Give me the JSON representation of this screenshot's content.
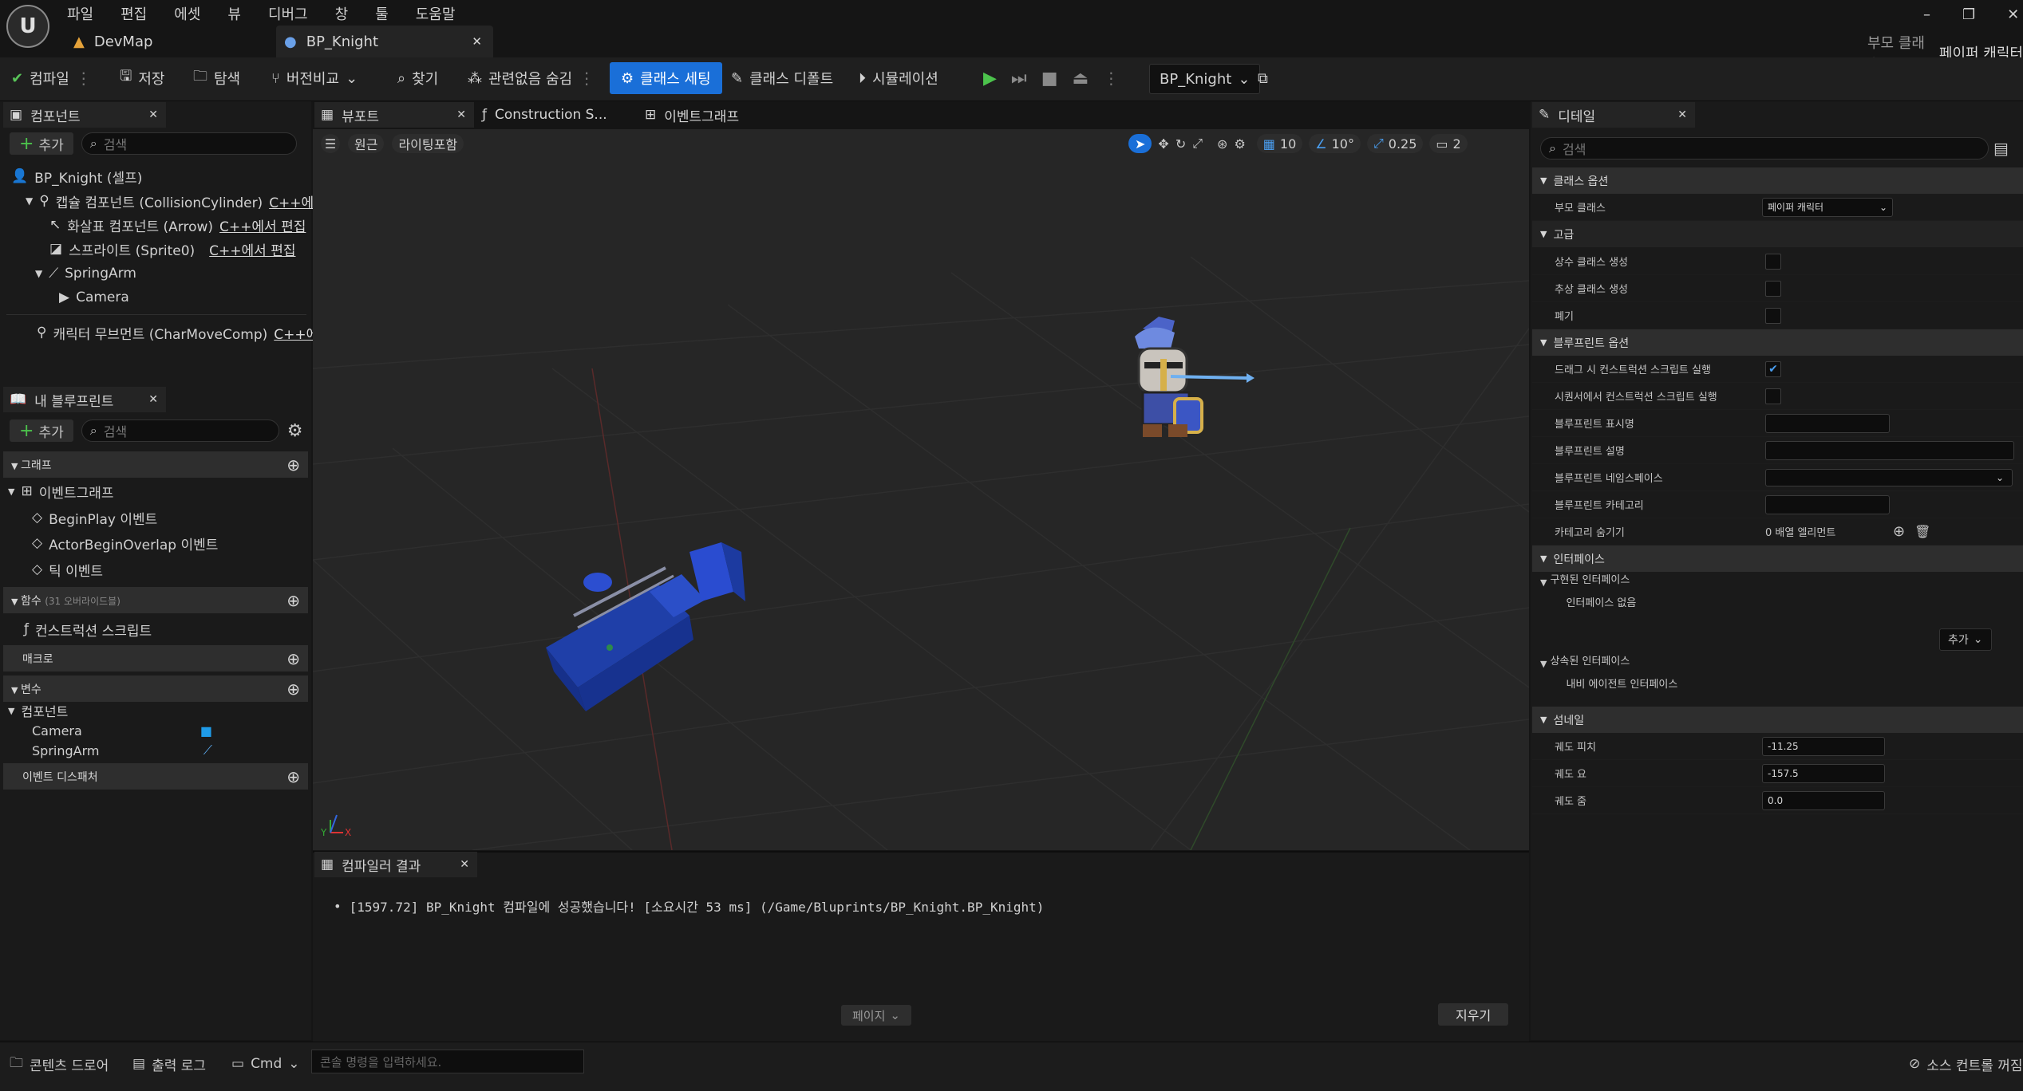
{
  "menu": [
    "파일",
    "편집",
    "에셋",
    "뷰",
    "디버그",
    "창",
    "툴",
    "도움말"
  ],
  "tabs": {
    "devmap": "DevMap",
    "bp": "BP_Knight"
  },
  "parent_class": {
    "label": "부모 클래스:",
    "value": "페이퍼 캐릭터"
  },
  "window_controls": {
    "min": "–",
    "max": "❐",
    "close": "✕"
  },
  "toolbar": {
    "compile": "컴파일",
    "save": "저장",
    "browse": "탐색",
    "diff": "버전비교",
    "find": "찾기",
    "hide_unrelated": "관련없음 숨김",
    "class_settings": "클래스 세팅",
    "class_defaults": "클래스 디폴트",
    "simulation": "시뮬레이션",
    "debug_object": "BP_Knight"
  },
  "components_panel": {
    "title": "컴포넌트",
    "add": "추가",
    "search_placeholder": "검색",
    "root": "BP_Knight (셀프)",
    "items": [
      {
        "label": "캡슐 컴포넌트 (CollisionCylinder)",
        "link": "C++에..."
      },
      {
        "label": "화살표 컴포넌트 (Arrow)",
        "link": "C++에서 편집"
      },
      {
        "label": "스프라이트 (Sprite0)",
        "link": "C++에서 편집"
      },
      {
        "label": "SpringArm",
        "link": ""
      },
      {
        "label": "Camera",
        "link": ""
      },
      {
        "label": "캐릭터 무브먼트 (CharMoveComp)",
        "link": "C++에..."
      }
    ]
  },
  "blueprint_panel": {
    "title": "내 블루프린트",
    "add": "추가",
    "search_placeholder": "검색",
    "graph": "그래프",
    "event_graph": "이벤트그래프",
    "events": [
      "BeginPlay 이벤트",
      "ActorBeginOverlap 이벤트",
      "틱 이벤트"
    ],
    "functions": "함수",
    "functions_note": "(31 오버라이드블)",
    "construction": "컨스트럭션 스크립트",
    "macros": "매크로",
    "variables": "변수",
    "components": "컴포넌트",
    "component_vars": [
      "Camera",
      "SpringArm"
    ],
    "event_dispatchers": "이벤트 디스패처"
  },
  "center_tabs": {
    "viewport": "뷰포트",
    "construction": "Construction S...",
    "event_graph": "이벤트그래프"
  },
  "viewport": {
    "perspective": "원근",
    "lighting": "라이팅포함",
    "grid": "10",
    "angle": "10°",
    "scale": "0.25",
    "camera": "2"
  },
  "compiler": {
    "title": "컴파일러 결과",
    "message": "[1597.72] BP_Knight 컴파일에 성공했습니다! [소요시간 53 ms] (/Game/Bluprints/BP_Knight.BP_Knight)",
    "page": "페이지",
    "clear": "지우기"
  },
  "details": {
    "title": "디테일",
    "search_placeholder": "검색",
    "class_options": "클래스 옵션",
    "parent_class_label": "부모 클래스",
    "parent_class_value": "페이퍼 캐릭터",
    "advanced": "고급",
    "const_class": "상수 클래스 생성",
    "abstract_class": "추상 클래스 생성",
    "deprecated": "폐기",
    "bp_options": "블루프린트 옵션",
    "run_cs_on_drag": "드래그 시 컨스트럭션 스크립트 실행",
    "run_cs_in_sequencer": "시퀀서에서 컨스트럭션 스크립트 실행",
    "display_name": "블루프린트 표시명",
    "description": "블루프린트 설명",
    "namespace": "블루프린트 네임스페이스",
    "category": "블루프린트 카테고리",
    "hide_categories": "카테고리 숨기기",
    "hide_categories_value": "0 배열 엘리먼트",
    "interfaces": "인터페이스",
    "implemented": "구현된 인터페이스",
    "no_interface": "인터페이스 없음",
    "add": "추가",
    "inherited": "상속된 인터페이스",
    "inherited_item": "내비 에이전트 인터페이스",
    "thumbnail": "섬네일",
    "orbit_pitch": "궤도 피치",
    "orbit_pitch_value": "-11.25",
    "orbit_yaw": "궤도 요",
    "orbit_yaw_value": "-157.5",
    "orbit_zoom": "궤도 줌",
    "orbit_zoom_value": "0.0"
  },
  "statusbar": {
    "content_drawer": "콘텐츠 드로어",
    "output_log": "출력 로그",
    "cmd": "Cmd",
    "console_placeholder": "콘솔 명령을 입력하세요.",
    "source_control": "소스 컨트롤 꺼짐"
  },
  "colors": {
    "accent": "#1a6fd8",
    "play": "#4cc34c",
    "panel": "#1a1a1a",
    "section": "#2e2e2e"
  }
}
